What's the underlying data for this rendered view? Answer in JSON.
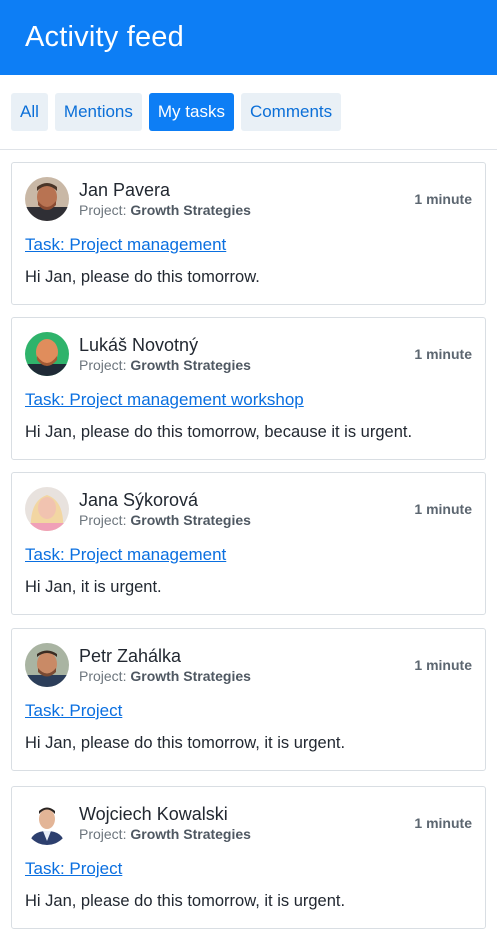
{
  "header": {
    "title": "Activity feed",
    "color": "#0d7ef5"
  },
  "tabs": [
    {
      "label": "All",
      "active": false
    },
    {
      "label": "Mentions",
      "active": false
    },
    {
      "label": "My tasks",
      "active": true
    },
    {
      "label": "Comments",
      "active": false
    }
  ],
  "project_prefix": "Project:",
  "items": [
    {
      "name": "Jan Pavera",
      "project": "Growth Strategies",
      "time": "1 minute",
      "task": "Task: Project management",
      "message": "Hi Jan, please do this tomorrow."
    },
    {
      "name": "Lukáš Novotný",
      "project": "Growth Strategies",
      "time": "1 minute",
      "task": "Task: Project management workshop",
      "message": "Hi Jan, please do this tomorrow, because it is urgent."
    },
    {
      "name": "Jana Sýkorová",
      "project": "Growth Strategies",
      "time": "1 minute",
      "task": "Task: Project management",
      "message": "Hi Jan, it is urgent."
    },
    {
      "name": "Petr Zahálka",
      "project": "Growth Strategies",
      "time": "1 minute",
      "task": "Task: Project",
      "message": "Hi Jan, please do this tomorrow, it is urgent."
    },
    {
      "name": "Wojciech Kowalski",
      "project": "Growth Strategies",
      "time": "1 minute",
      "task": "Task: Project",
      "message": "Hi Jan, please do this tomorrow, it is urgent."
    }
  ]
}
